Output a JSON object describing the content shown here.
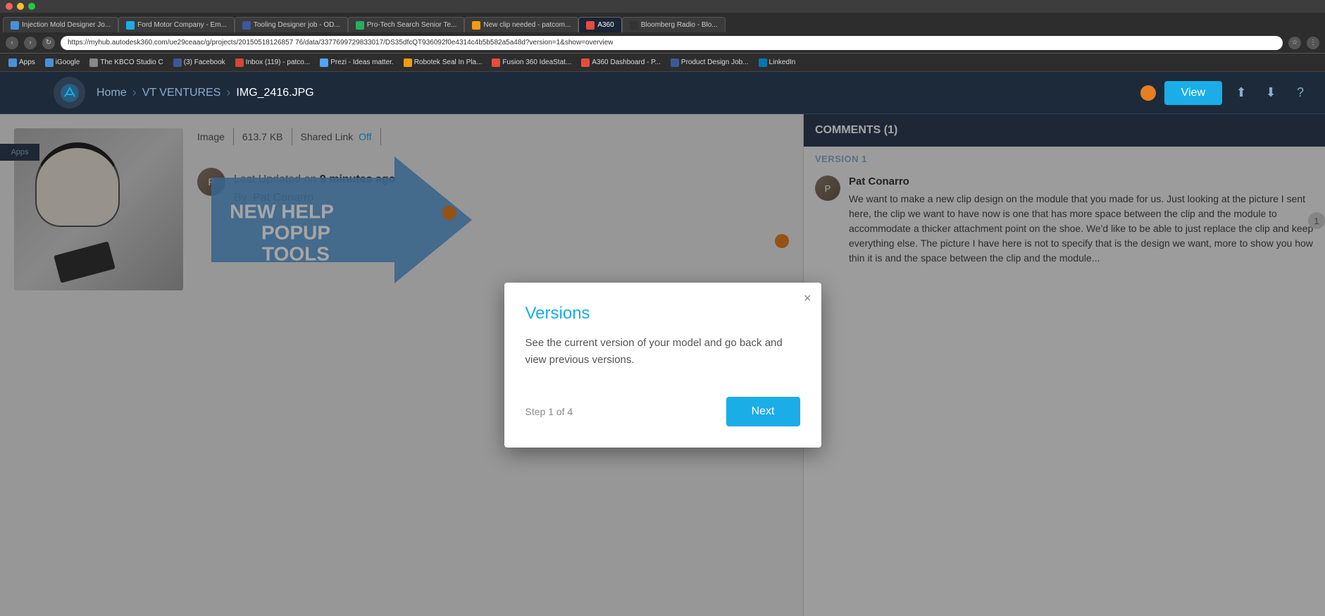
{
  "browser": {
    "traffic_lights": [
      "red",
      "yellow",
      "green"
    ],
    "tabs": [
      {
        "id": "tab1",
        "label": "Injection Mold Designer Jo...",
        "active": false,
        "favicon_color": "#4a90d9"
      },
      {
        "id": "tab2",
        "label": "Ford Motor Company - Em...",
        "active": false,
        "favicon_color": "#1aade8"
      },
      {
        "id": "tab3",
        "label": "Tooling Designer job - OD...",
        "active": false,
        "favicon_color": "#3b5998"
      },
      {
        "id": "tab4",
        "label": "Pro-Tech Search Senior Te...",
        "active": false,
        "favicon_color": "#27ae60"
      },
      {
        "id": "tab5",
        "label": "New clip needed - patcom...",
        "active": false,
        "favicon_color": "#f39c12"
      },
      {
        "id": "tab6",
        "label": "A360",
        "active": true,
        "favicon_color": "#e74c3c"
      },
      {
        "id": "tab7",
        "label": "Bloomberg Radio - Blo...",
        "active": false,
        "favicon_color": "#333"
      }
    ],
    "url": "https://myhub.autodesk360.com/ue29ceaac/g/projects/20150518126857 76/data/3377699729833017/DS35dfcQT936092f0e4314c4b5b582a5a48d?version=1&show=overview",
    "bookmarks": [
      {
        "label": "Apps",
        "icon_color": "#4a90d9"
      },
      {
        "label": "iGoogle",
        "icon_color": "#4a90d9"
      },
      {
        "label": "The KBCO Studio C",
        "icon_color": "#888"
      },
      {
        "label": "(3) Facebook",
        "icon_color": "#3b5998"
      },
      {
        "label": "Inbox (119) - patco...",
        "icon_color": "#d44638"
      },
      {
        "label": "Prezi - Ideas matter.",
        "icon_color": "#4da6ff"
      },
      {
        "label": "Robotek Seal In Pla...",
        "icon_color": "#f39c12"
      },
      {
        "label": "Fusion 360 IdeaStat...",
        "icon_color": "#e74c3c"
      },
      {
        "label": "A360 Dashboard - P...",
        "icon_color": "#e74c3c"
      },
      {
        "label": "Product Design Job...",
        "icon_color": "#3b5998"
      },
      {
        "label": "LinkedIn",
        "icon_color": "#0077b5"
      }
    ]
  },
  "nav": {
    "breadcrumbs": [
      "Home",
      "VT VENTURES",
      "IMG_2416.JPG"
    ],
    "view_button_label": "View",
    "apps_label": "Apps"
  },
  "file": {
    "type": "Image",
    "size": "613.7 KB",
    "shared_link_label": "Shared Link",
    "shared_link_value": "Off",
    "last_updated_label": "Last Updated on",
    "last_updated_value": "9 minutes ago",
    "by_label": "By",
    "author": "Pat Conarro"
  },
  "help_popup": {
    "arrow_text": "NEW HELP POPUP TOOLS"
  },
  "modal": {
    "title": "Versions",
    "body": "See the current version of your model and go back and view previous versions.",
    "step_label": "Step 1 of 4",
    "next_button_label": "Next",
    "close_label": "×"
  },
  "right_panel": {
    "comments_header": "COMMENTS (1)",
    "version_label": "VERSION 1",
    "commenter_name": "Pat Conarro",
    "comment_number": "1",
    "comment_text": "We want to make a new clip design on the module that you made for us. Just looking at the picture I sent here, the clip we want to have now is one that has more space between the clip and the module to accommodate a thicker attachment point on the shoe. We'd like to be able to just replace the clip and keep everything else. The picture I have here is not to specify that is the design we want, more to show you how thin it is and the space between the clip and the module..."
  }
}
